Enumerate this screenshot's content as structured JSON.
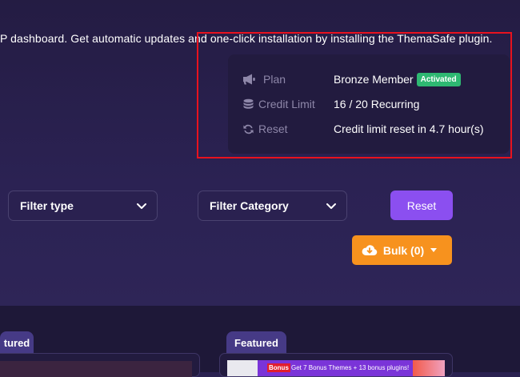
{
  "notice": {
    "text": "P dashboard. Get automatic updates and one-click installation by installing the ThemaSafe plugin."
  },
  "account": {
    "plan_label": "Plan",
    "plan_value": "Bronze Member",
    "plan_badge": "Activated",
    "credit_label": "Credit Limit",
    "credit_value": "16 / 20 Recurring",
    "reset_label": "Reset",
    "reset_value": "Credit limit reset in 4.7 hour(s)"
  },
  "filters": {
    "type_label": "Filter type",
    "category_label": "Filter Category",
    "reset_label": "Reset",
    "bulk_label": "Bulk (0)"
  },
  "cards": [
    {
      "tab_label": "tured"
    },
    {
      "tab_label": "Featured",
      "thumb_badge": "Bonus",
      "thumb_text": "Get  7 Bonus Themes + 13 bonus plugins!"
    }
  ],
  "colors": {
    "background": "#2a2150",
    "accent_purple": "#8b4ff0",
    "accent_orange": "#f7921e",
    "badge_green": "#2eb872",
    "highlight_red": "#e8121e"
  }
}
